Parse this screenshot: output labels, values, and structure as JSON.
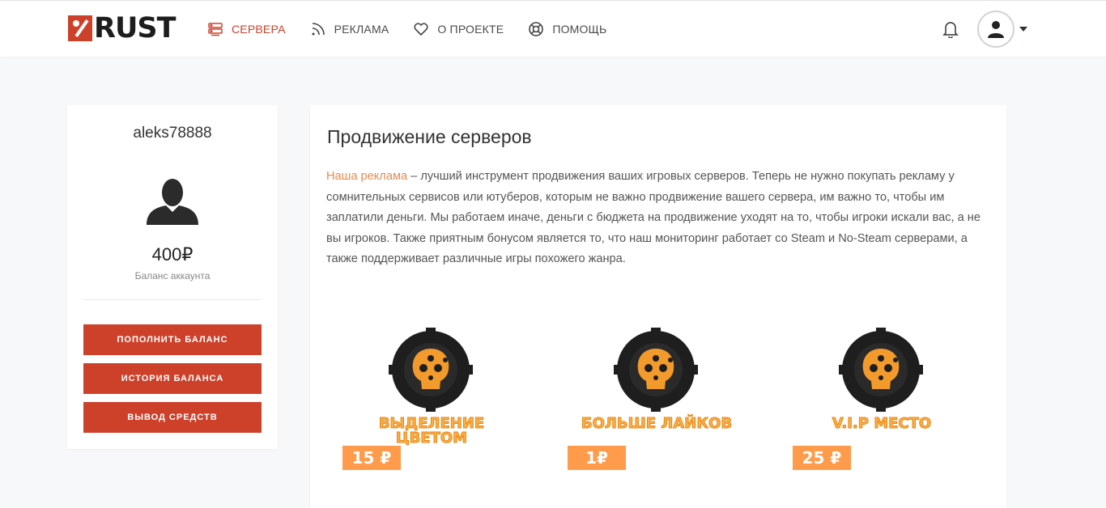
{
  "header": {
    "logo_text": "RUST",
    "nav": [
      {
        "label": "Сервера",
        "icon": "server-icon",
        "active": true
      },
      {
        "label": "Реклама",
        "icon": "rss-icon",
        "active": false
      },
      {
        "label": "О проекте",
        "icon": "heart-icon",
        "active": false
      },
      {
        "label": "Помощь",
        "icon": "lifebuoy-icon",
        "active": false
      }
    ],
    "notifications_icon": "bell-icon",
    "user_menu_icon": "user-icon"
  },
  "profile": {
    "username": "aleks78888",
    "balance": "400₽",
    "balance_label": "Баланс аккаунта",
    "buttons": {
      "topup": "Пополнить баланс",
      "history": "История баланса",
      "withdraw": "Вывод средств"
    }
  },
  "content": {
    "title": "Продвижение серверов",
    "link_text": "Наша реклама",
    "paragraph": " – лучший инструмент продвижения ваших игровых серверов. Теперь не нужно покупать рекламу у сомнительных сервисов или ютуберов, которым не важно продвижение вашего сервера, им важно то, чтобы им заплатили деньги. Мы работаем иначе, деньги с бюджета на продвижение уходят на то, чтобы игроки искали вас, а не вы игроков. Также приятным бонусом является то, что наш мониторинг работает со Steam и No-Steam серверами, а также поддерживает различные игры похожего жанра.",
    "promos": [
      {
        "label": "Выделение цветом",
        "price": "15 ₽"
      },
      {
        "label": "Больше лайков",
        "price": "1₽"
      },
      {
        "label": "V.I.P место",
        "price": "25 ₽"
      }
    ]
  },
  "colors": {
    "accent": "#cd412b",
    "link": "#e78a4c",
    "promo_orange": "#ff9b4a",
    "promo_text": "#fbb049"
  }
}
